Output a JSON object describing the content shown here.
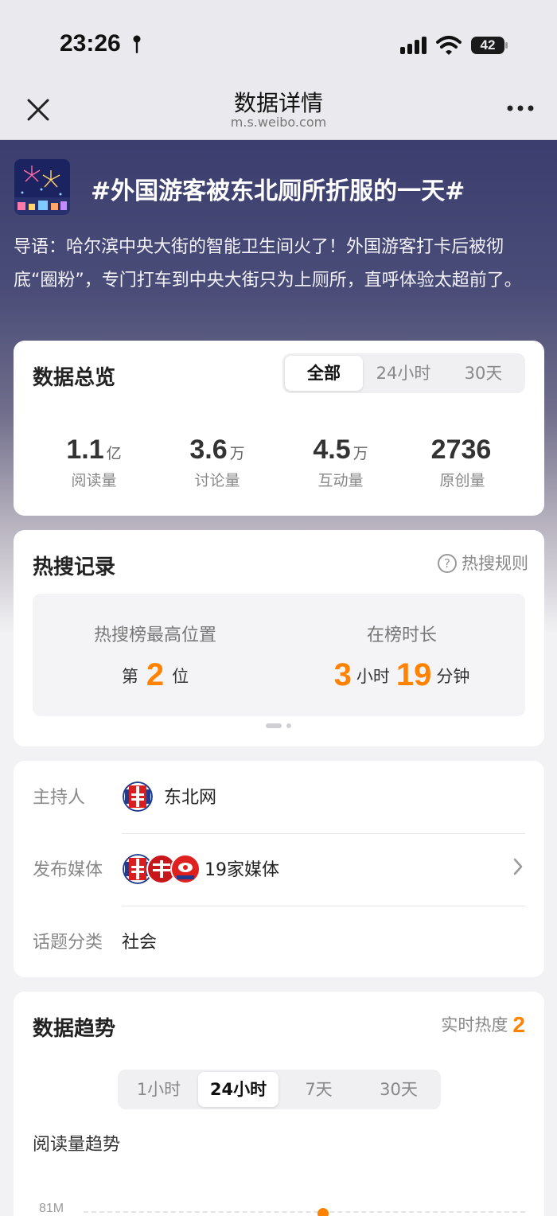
{
  "status_bar": {
    "time": "23:26",
    "battery": "42"
  },
  "nav": {
    "title": "数据详情",
    "url": "m.s.weibo.com"
  },
  "topic": {
    "title": "#外国游客被东北厕所折服的一天#",
    "intro": "导语：哈尔滨中央大街的智能卫生间火了！外国游客打卡后被彻底“圈粉”，专门打车到中央大街只为上厕所，直呼体验太超前了。"
  },
  "overview": {
    "title": "数据总览",
    "tabs": [
      "全部",
      "24小时",
      "30天"
    ],
    "active_tab": 0,
    "stats": [
      {
        "value": "1.1",
        "unit": "亿",
        "label": "阅读量"
      },
      {
        "value": "3.6",
        "unit": "万",
        "label": "讨论量"
      },
      {
        "value": "4.5",
        "unit": "万",
        "label": "互动量"
      },
      {
        "value": "2736",
        "unit": "",
        "label": "原创量"
      }
    ]
  },
  "hot_search": {
    "title": "热搜记录",
    "rules_link": "热搜规则",
    "help_icon": "?",
    "peak_label": "热搜榜最高位置",
    "peak_prefix": "第",
    "peak_value": "2",
    "peak_suffix": "位",
    "duration_label": "在榜时长",
    "hours": "3",
    "hours_unit": "小时",
    "minutes": "19",
    "minutes_unit": "分钟",
    "page_index": 0,
    "page_count": 2
  },
  "info": {
    "host_label": "主持人",
    "host_name": "东北网",
    "media_label": "发布媒体",
    "media_count": "19家媒体",
    "category_label": "话题分类",
    "category_value": "社会"
  },
  "trend": {
    "title": "数据趋势",
    "realtime_label": "实时热度",
    "realtime_value": "2",
    "tabs": [
      "1小时",
      "24小时",
      "7天",
      "30天"
    ],
    "active_tab": 1,
    "subtitle": "阅读量趋势",
    "y_tick": "81M"
  },
  "colors": {
    "accent": "#ff8200",
    "logo_red": "#d81e1e",
    "logo_blue": "#1f3c8f"
  },
  "icons": [
    "location-icon",
    "signal-icon",
    "wifi-icon",
    "battery-icon",
    "close-icon",
    "more-icon",
    "help-icon",
    "chevron-right-icon"
  ]
}
